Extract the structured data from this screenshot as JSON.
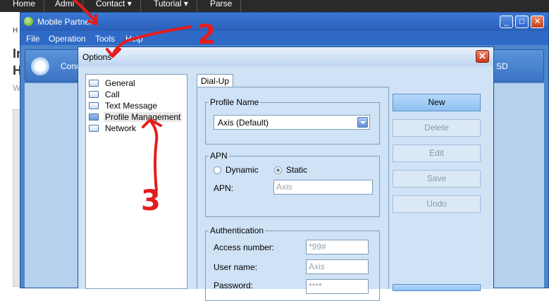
{
  "web_page": {
    "nav_items": [
      "Home",
      "Admi",
      "Contact ▾",
      "Tutorial ▾",
      "Parse"
    ],
    "breadcrumb": "H",
    "heading_fragments": [
      "In",
      "H"
    ],
    "text_fragment": "W"
  },
  "mobile_partner": {
    "title": "Mobile Partner",
    "menu": [
      "File",
      "Operation",
      "Tools",
      "Help"
    ],
    "toolbar": {
      "connect_label": "Conn",
      "ussd_label": "SD"
    },
    "window_buttons": {
      "minimize": "_",
      "maximize": "□",
      "close": "✕"
    }
  },
  "options_dialog": {
    "title": "Options",
    "close_glyph": "✕",
    "tree": [
      {
        "label": "General",
        "icon": "folder-icon"
      },
      {
        "label": "Call",
        "icon": "folder-icon"
      },
      {
        "label": "Text Message",
        "icon": "folder-icon"
      },
      {
        "label": "Profile Management",
        "icon": "open-folder-icon",
        "selected": true
      },
      {
        "label": "Network",
        "icon": "folder-icon"
      }
    ],
    "tab": "Dial-Up",
    "profile_name": {
      "group_title": "Profile Name",
      "selected": "Axis (Default)"
    },
    "apn": {
      "group_title": "APN",
      "radio_dynamic": "Dynamic",
      "radio_static": "Static",
      "selected": "Static",
      "field_label": "APN:",
      "field_value": "Axis"
    },
    "authentication": {
      "group_title": "Authentication",
      "access_number_label": "Access number:",
      "access_number_value": "*99#",
      "username_label": "User name:",
      "username_value": "Axis",
      "password_label": "Password:",
      "password_value": "****"
    },
    "buttons": {
      "new": "New",
      "delete": "Delete",
      "edit": "Edit",
      "save": "Save",
      "undo": "Undo"
    }
  },
  "annotations": {
    "step_2": "2",
    "step_3": "3"
  },
  "colors": {
    "annotation_red": "#e51c1c",
    "titlebar_blue": "#2a5fb8",
    "dialog_bg": "#cfe2f6"
  }
}
